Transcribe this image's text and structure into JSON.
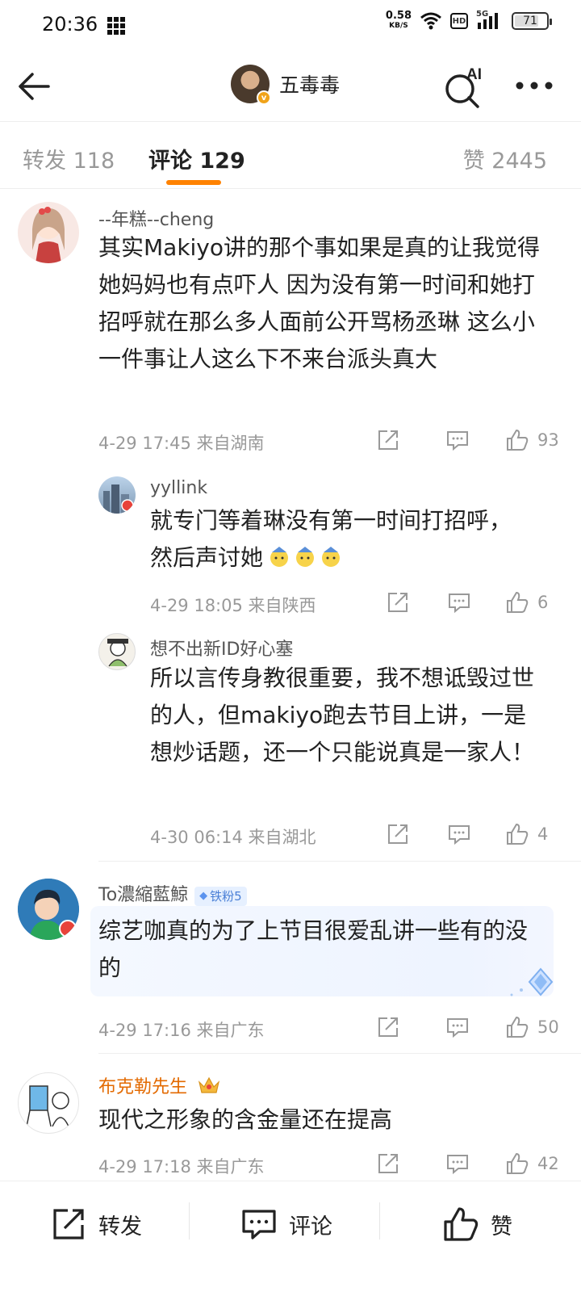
{
  "status_bar": {
    "time": "20:36",
    "net_speed": "0.58",
    "net_unit": "KB/S",
    "hd": "HD",
    "signal": "5G",
    "battery": "71"
  },
  "nav": {
    "title": "五毒毒",
    "ai_label": "AI"
  },
  "tabs": {
    "repost": "转发 118",
    "comment": "评论 129",
    "likes": "赞 2445"
  },
  "comments": [
    {
      "username": "--年糕--cheng",
      "content": "其实Makiyo讲的那个事如果是真的让我觉得她妈妈也有点吓人 因为没有第一时间和她打招呼就在那么多人面前公开骂杨丞琳 这么小一件事让人这么下不来台派头真大",
      "meta": "4-29 17:45 来自湖南",
      "likes": "93"
    },
    {
      "username": "yyllink",
      "content": "就专门等着琳没有第一时间打招呼，然后声讨她",
      "meta": "4-29 18:05 来自陕西",
      "likes": "6"
    },
    {
      "username": "想不出新ID好心塞",
      "content": "所以言传身教很重要，我不想诋毁过世的人，但makiyo跑去节目上讲，一是想炒话题，还一个只能说真是一家人！",
      "meta": "4-30 06:14 来自湖北",
      "likes": "4"
    },
    {
      "username": "To濃縮藍鯨",
      "badge": "铁粉5",
      "content": "综艺咖真的为了上节目很爱乱讲一些有的没的",
      "meta": "4-29 17:16 来自广东",
      "likes": "50"
    },
    {
      "username": "布克勒先生",
      "content": "现代之形象的含金量还在提高",
      "meta": "4-29 17:18 来自广东",
      "likes": "42"
    }
  ],
  "bottom_bar": {
    "repost": "转发",
    "comment": "评论",
    "like": "赞"
  },
  "colors": {
    "accent": "#ff8200",
    "gold_name": "#e36a00",
    "fan_badge": "#4a7fd6"
  }
}
